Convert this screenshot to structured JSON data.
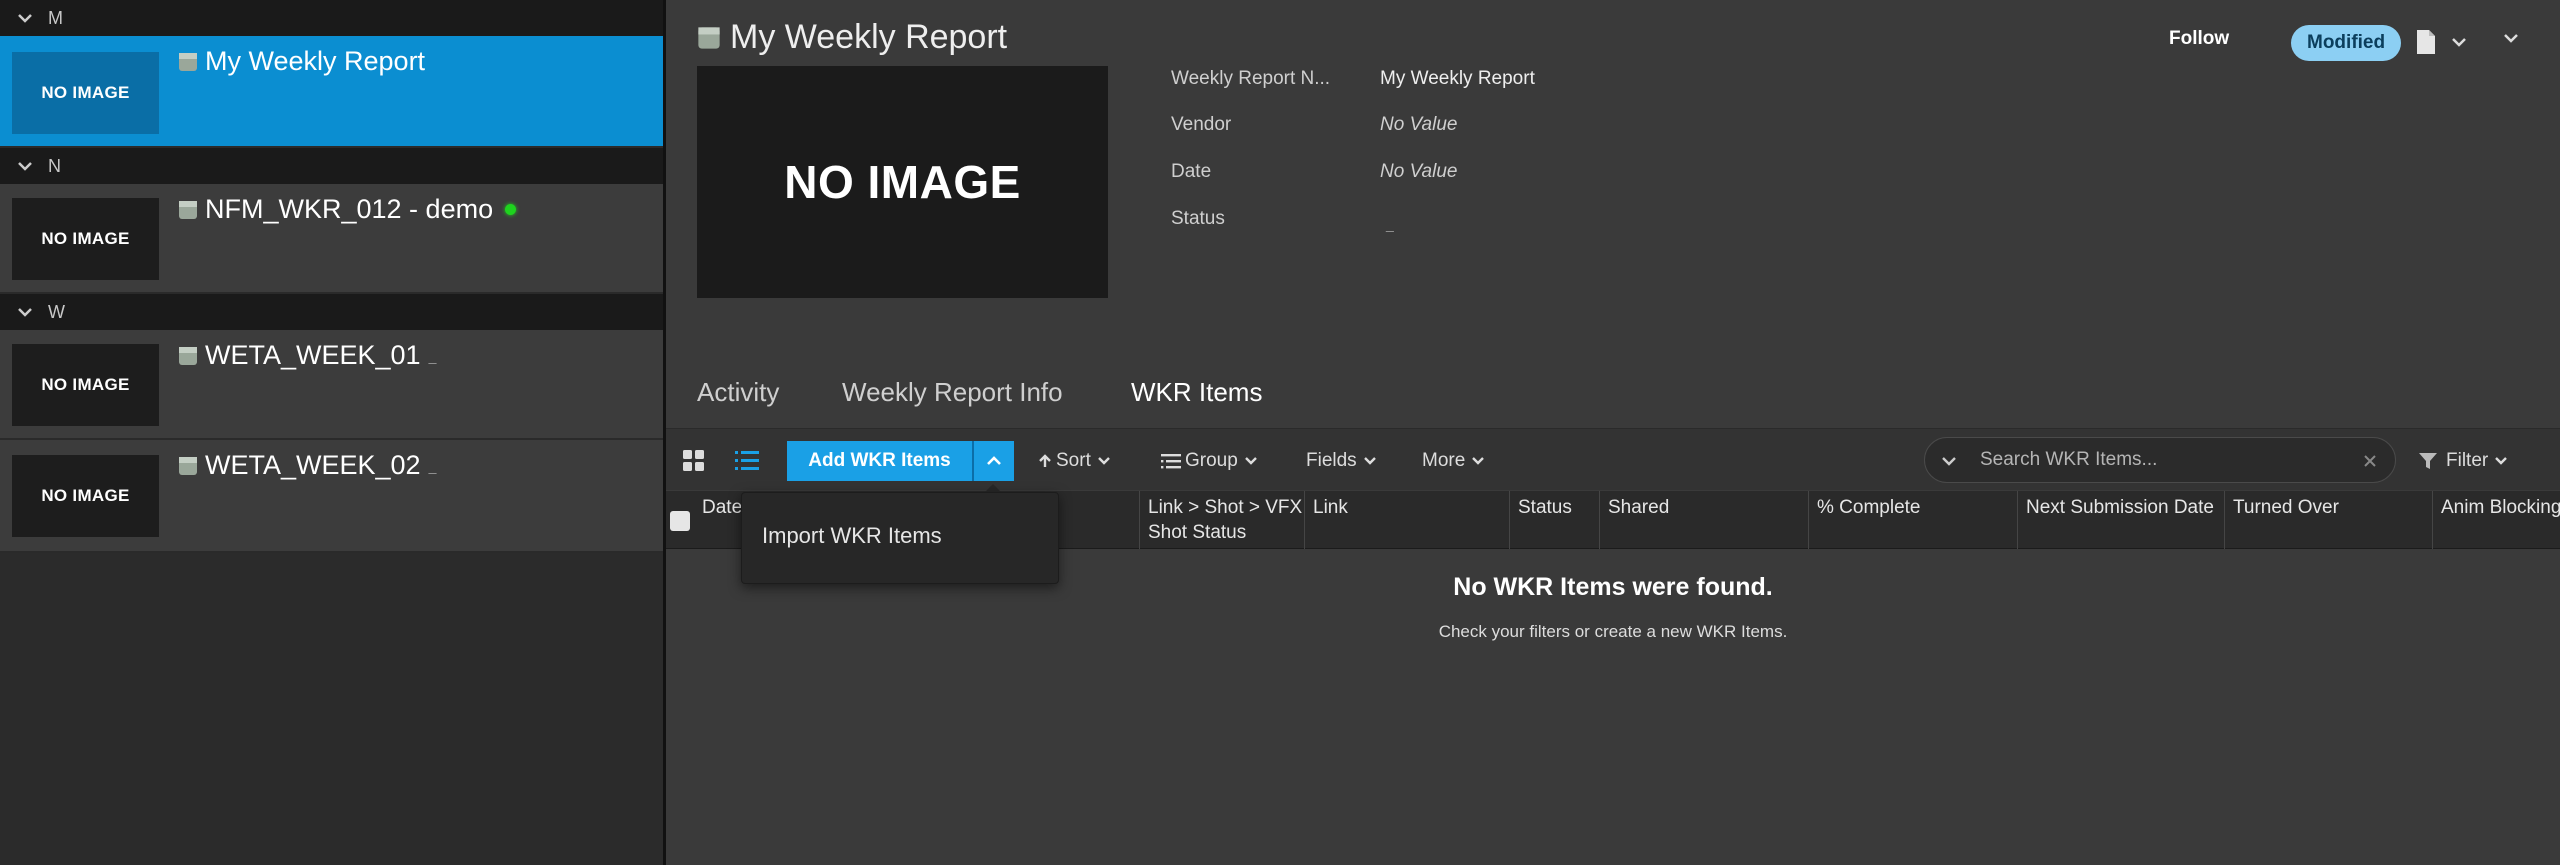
{
  "colors": {
    "selected_row": "#0b8ed1",
    "accent_button": "#1aa0e6",
    "modified_badge": "#8ccff3",
    "online_dot": "#1ed41e"
  },
  "sidebar": {
    "groups": [
      {
        "letter": "M",
        "items": [
          {
            "title": "My Weekly Report",
            "thumb": "NO IMAGE",
            "selected": true
          }
        ]
      },
      {
        "letter": "N",
        "items": [
          {
            "title": "NFM_WKR_012 - demo",
            "thumb": "NO IMAGE",
            "online": true
          }
        ]
      },
      {
        "letter": "W",
        "items": [
          {
            "title": "WETA_WEEK_01",
            "thumb": "NO IMAGE",
            "suffix": "_"
          },
          {
            "title": "WETA_WEEK_02",
            "thumb": "NO IMAGE",
            "suffix": "_"
          }
        ]
      }
    ]
  },
  "detail": {
    "title": "My Weekly Report",
    "hero_text": "NO IMAGE",
    "follow_label": "Follow",
    "status_badge": "Modified",
    "fields": [
      {
        "label": "Weekly Report N...",
        "value": "My Weekly Report"
      },
      {
        "label": "Vendor",
        "value": "No Value"
      },
      {
        "label": "Date",
        "value": "No Value"
      },
      {
        "label": "Status",
        "value": "_"
      }
    ],
    "tabs": [
      "Activity",
      "Weekly Report Info",
      "WKR Items"
    ],
    "active_tab": "WKR Items"
  },
  "toolbar": {
    "add_label": "Add WKR Items",
    "sort_label": "Sort",
    "group_label": "Group",
    "fields_label": "Fields",
    "more_label": "More",
    "search_placeholder": "Search WKR Items...",
    "filter_label": "Filter"
  },
  "dropdown": {
    "import_label": "Import WKR Items"
  },
  "table": {
    "columns": [
      "Date",
      "Link > Shot > VFX Shot Status",
      "Link",
      "Status",
      "Shared",
      "% Complete",
      "Next Submission Date",
      "Turned Over",
      "Anim Blocking"
    ],
    "empty_title": "No WKR Items were found.",
    "empty_subtitle": "Check your filters or create a new WKR Items."
  }
}
